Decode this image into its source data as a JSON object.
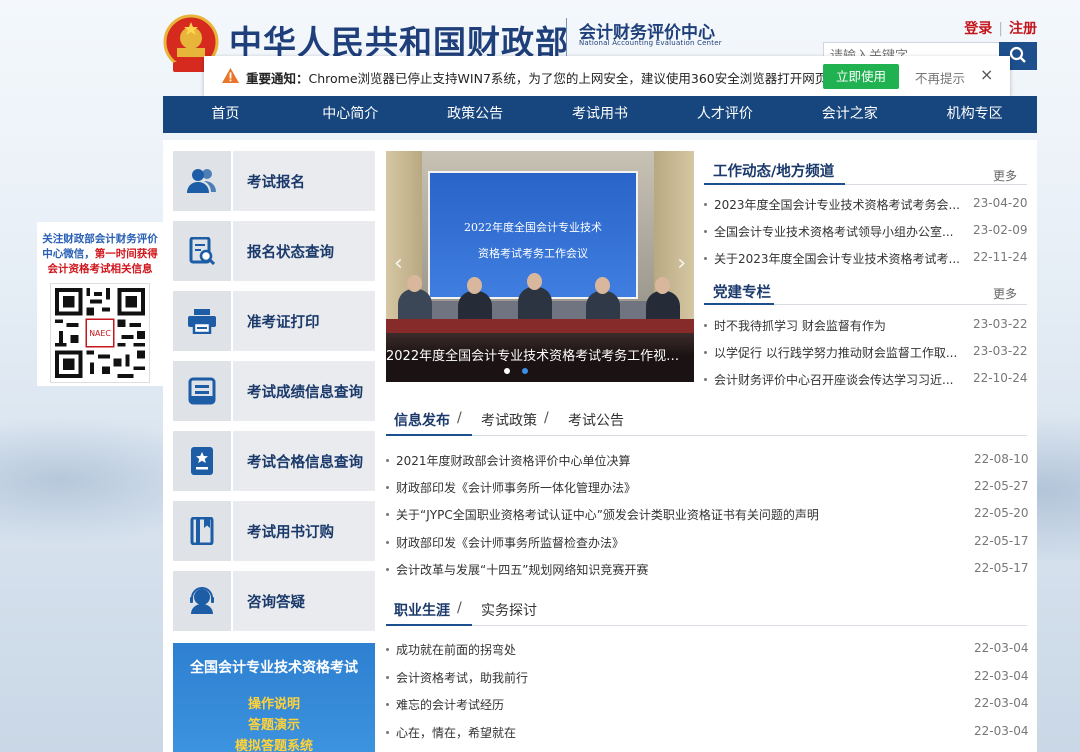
{
  "header": {
    "ministry": "中华人民共和国财政部",
    "center_cn": "会计财务评价中心",
    "center_en": "National Accounting Evaluation Center",
    "login": "登录",
    "register": "注册",
    "search_placeholder": "请输入关键字"
  },
  "notice": {
    "label": "重要通知：",
    "message": "Chrome浏览器已停止支持WIN7系统，为了您的上网安全，建议使用360安全浏览器打开网页",
    "use_button": "立即使用",
    "dismiss": "不再提示",
    "close": "×"
  },
  "nav": [
    "首页",
    "中心简介",
    "政策公告",
    "考试用书",
    "人才评价",
    "会计之家",
    "机构专区"
  ],
  "sidebar": [
    {
      "label": "考试报名",
      "icon": "users-icon"
    },
    {
      "label": "报名状态查询",
      "icon": "status-search-icon"
    },
    {
      "label": "准考证打印",
      "icon": "printer-icon"
    },
    {
      "label": "考试成绩信息查询",
      "icon": "score-icon"
    },
    {
      "label": "考试合格信息查询",
      "icon": "certificate-icon"
    },
    {
      "label": "考试用书订购",
      "icon": "book-icon"
    },
    {
      "label": "咨询答疑",
      "icon": "consult-icon"
    }
  ],
  "exam_box": {
    "title": "全国会计专业技术资格考试",
    "links": [
      "操作说明",
      "答题演示",
      "模拟答题系统"
    ]
  },
  "slider": {
    "screen_line1": "2022年度全国会计专业技术",
    "screen_line2": "资格考试考务工作会议",
    "caption": "2022年度全国会计专业技术资格考试考务工作视频会议"
  },
  "work_news": {
    "title": "工作动态/地方频道",
    "more": "更多",
    "items": [
      {
        "title": "2023年度全国会计专业技术资格考试考务会...",
        "date": "23-04-20"
      },
      {
        "title": "全国会计专业技术资格考试领导小组办公室...",
        "date": "23-02-09"
      },
      {
        "title": "关于2023年度全国会计专业技术资格考试考...",
        "date": "22-11-24"
      }
    ]
  },
  "party": {
    "title": "党建专栏",
    "more": "更多",
    "items": [
      {
        "title": "时不我待抓学习 财会监督有作为",
        "date": "23-03-22"
      },
      {
        "title": "以学促行 以行践学努力推动财会监督工作取...",
        "date": "23-03-22"
      },
      {
        "title": "会计财务评价中心召开座谈会传达学习习近...",
        "date": "22-10-24"
      }
    ]
  },
  "info": {
    "tabs": [
      "信息发布",
      "考试政策",
      "考试公告"
    ],
    "items": [
      {
        "title": "2021年度财政部会计资格评价中心单位决算",
        "date": "22-08-10"
      },
      {
        "title": "财政部印发《会计师事务所一体化管理办法》",
        "date": "22-05-27"
      },
      {
        "title": "关于“JYPC全国职业资格考试认证中心”颁发会计类职业资格证书有关问题的声明",
        "date": "22-05-20"
      },
      {
        "title": "财政部印发《会计师事务所监督检查办法》",
        "date": "22-05-17"
      },
      {
        "title": "会计改革与发展“十四五”规划网络知识竞赛开赛",
        "date": "22-05-17"
      }
    ]
  },
  "career": {
    "tabs": [
      "职业生涯",
      "实务探讨"
    ],
    "items": [
      {
        "title": "成功就在前面的拐弯处",
        "date": "22-03-04"
      },
      {
        "title": "会计资格考试，助我前行",
        "date": "22-03-04"
      },
      {
        "title": "难忘的会计考试经历",
        "date": "22-03-04"
      },
      {
        "title": "心在，情在，希望就在",
        "date": "22-03-04"
      }
    ]
  },
  "wechat": {
    "line1": "关注财政部会计财务评价中心微信，",
    "line1_red": "第一时间获得",
    "line2": "会计资格考试相关信息",
    "qr_label": "NAEC"
  },
  "colors": {
    "nav": "#17467e",
    "accent_red": "#c4161c",
    "green_button": "#20b150",
    "title_blue": "#1b3a6b"
  }
}
